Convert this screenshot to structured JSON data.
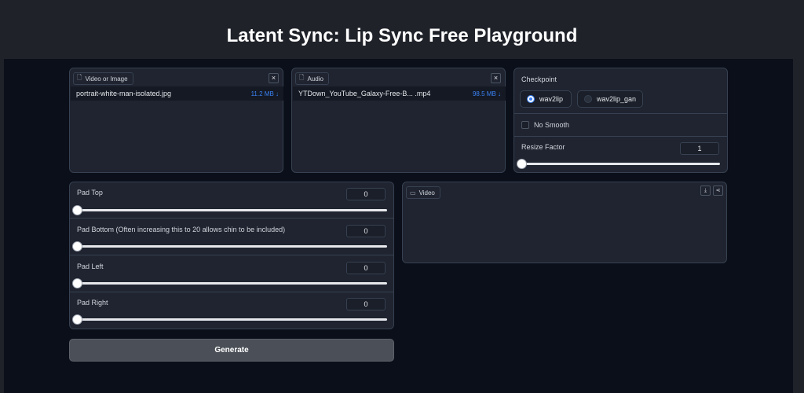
{
  "header": {
    "title": "Latent Sync: Lip Sync Free Playground"
  },
  "video_input": {
    "label": "Video or Image",
    "close": "×",
    "file_name": "portrait-white-man-isolated.jpg",
    "file_size": "11.2 MB ↓"
  },
  "audio_input": {
    "label": "Audio",
    "close": "×",
    "file_name": "YTDown_YouTube_Galaxy-Free-B... .mp4",
    "file_size": "98.5 MB ↓"
  },
  "settings": {
    "checkpoint_label": "Checkpoint",
    "options": [
      {
        "label": "wav2lip",
        "selected": true
      },
      {
        "label": "wav2lip_gan",
        "selected": false
      }
    ],
    "no_smooth_label": "No Smooth",
    "no_smooth_checked": false,
    "resize_label": "Resize Factor",
    "resize_value": "1",
    "resize_fraction": 0
  },
  "padding": {
    "sliders": [
      {
        "label": "Pad Top",
        "value": "0",
        "fraction": 0
      },
      {
        "label": "Pad Bottom (Often increasing this to 20 allows chin to be included)",
        "value": "0",
        "fraction": 0
      },
      {
        "label": "Pad Left",
        "value": "0",
        "fraction": 0
      },
      {
        "label": "Pad Right",
        "value": "0",
        "fraction": 0
      }
    ]
  },
  "output": {
    "label": "Video"
  },
  "actions": {
    "generate_label": "Generate"
  },
  "colors": {
    "accent": "#3b82f6",
    "background": "#0b0f19",
    "panel": "#1f2430"
  }
}
